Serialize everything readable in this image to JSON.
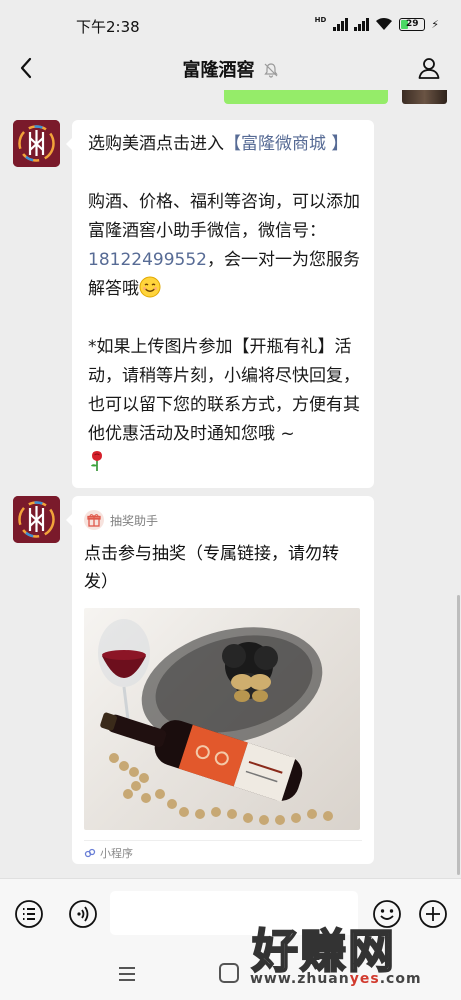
{
  "status_bar": {
    "time": "下午2:38",
    "network_badge": "HD",
    "battery_level": "29"
  },
  "header": {
    "title": "富隆酒窖"
  },
  "messages": {
    "first": {
      "line_a": "选购美酒点击进入",
      "shop_link": "【富隆微商城 】",
      "consult_text": "购酒、价格、福利等咨询，可以添加富隆酒窖小助手微信，微信号：",
      "wechat_id": "18122499552",
      "consult_tail": "，会一对一为您服务解答哦",
      "promo_text": "*如果上传图片参加【开瓶有礼】活动，请稍等片刻，小编将尽快回复，也可以留下您的联系方式，方便有其他优惠活动及时通知您哦 ~"
    },
    "miniprogram": {
      "source_name": "抽奖助手",
      "title": "点击参与抽奖（专属链接，请勿转发）",
      "footer_label": "小程序"
    }
  },
  "input_bar": {
    "placeholder": ""
  },
  "watermark": {
    "text": "好赚网",
    "url_prefix": "www.zhuan",
    "url_highlight": "yes",
    "url_suffix": ".com"
  },
  "icons": [
    "back-icon",
    "mute-icon",
    "profile-icon",
    "voice-icon",
    "audio-icon",
    "emoji-icon",
    "plus-icon",
    "gift-icon",
    "miniprogram-icon",
    "nav-menu-icon",
    "nav-home-icon"
  ],
  "colors": {
    "background": "#ededed",
    "link": "#576b95",
    "self_bubble": "#95ec69",
    "avatar_bg": "#7a1a2b"
  }
}
